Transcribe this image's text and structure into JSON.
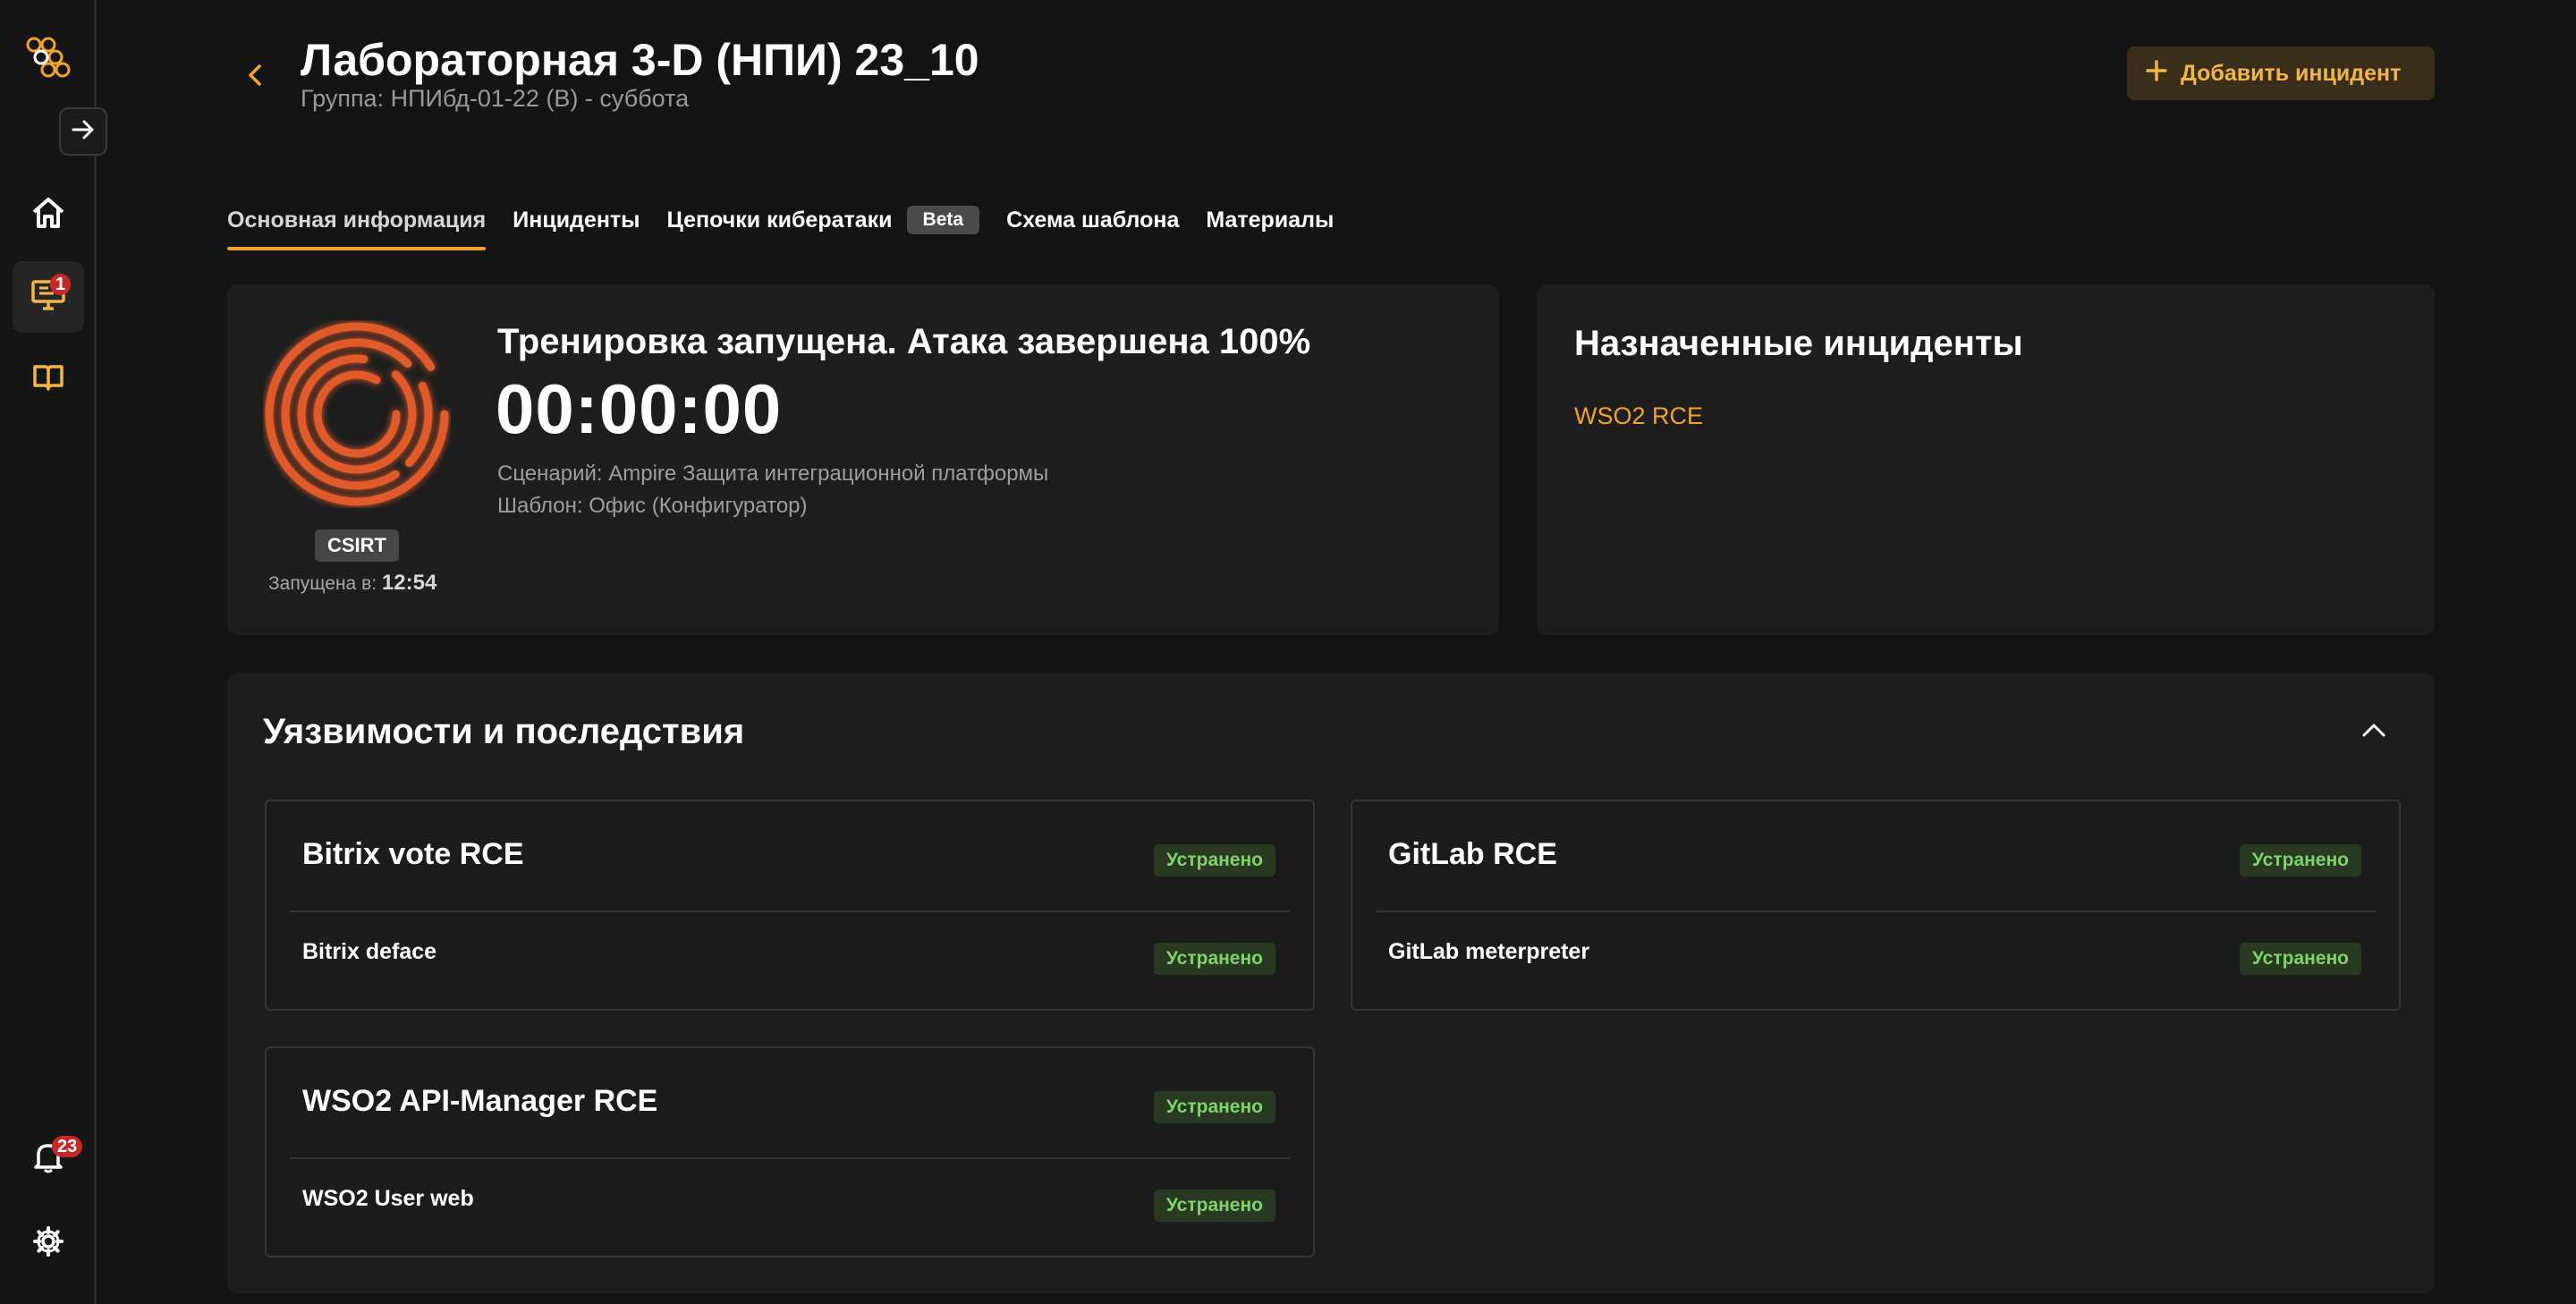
{
  "sidebar": {
    "items": [
      {
        "name": "home-icon"
      },
      {
        "name": "monitor-icon",
        "badge": "1"
      },
      {
        "name": "book-icon"
      }
    ],
    "notifications_badge": "23"
  },
  "header": {
    "title": "Лабораторная 3-D (НПИ) 23_10",
    "subtitle": "Группа: НПИбд-01-22 (В) - суббота",
    "add_button": "Добавить инцидент"
  },
  "tabs": [
    {
      "label": "Основная информация",
      "active": true
    },
    {
      "label": "Инциденты"
    },
    {
      "label": "Цепочки кибератаки",
      "badge": "Beta"
    },
    {
      "label": "Схема шаблона"
    },
    {
      "label": "Материалы"
    }
  ],
  "status": {
    "title": "Тренировка запущена. Атака завершена 100%",
    "timer": "00:00:00",
    "scenario": "Сценарий: Ampire Защита интеграционной платформы",
    "template": "Шаблон: Офис (Конфигуратор)",
    "team": "CSIRT",
    "started_label": "Запущена в:",
    "started_time": "12:54"
  },
  "assigned": {
    "title": "Назначенные инциденты",
    "incidents": [
      "WSO2 RCE"
    ]
  },
  "vulnerabilities": {
    "title": "Уязвимости и последствия",
    "items": [
      {
        "title": "Bitrix vote RCE",
        "status": "Устранено",
        "sub": "Bitrix deface",
        "sub_status": "Устранено"
      },
      {
        "title": "GitLab RCE",
        "status": "Устранено",
        "sub": "GitLab meterpreter",
        "sub_status": "Устранено"
      },
      {
        "title": "WSO2 API-Manager RCE",
        "status": "Устранено",
        "sub": "WSO2 User web",
        "sub_status": "Устранено"
      }
    ]
  },
  "colors": {
    "accent": "#f2a32f",
    "ring": "#e05a2b",
    "success": "#7ed46a",
    "badge_red": "#c62828"
  }
}
